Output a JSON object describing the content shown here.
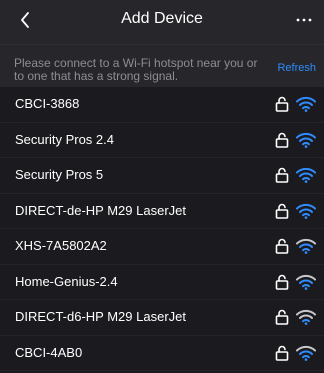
{
  "header": {
    "title": "Add Device",
    "back_icon": "chevron-left-icon",
    "more_icon": "ellipsis-icon"
  },
  "banner": {
    "message": "Please connect to a Wi-Fi hotspot near you or to one that has a strong signal.",
    "refresh_label": "Refresh"
  },
  "colors": {
    "accent": "#2f8cff",
    "background": "#1b1b1f",
    "header_background": "#26262b",
    "muted_text": "#8d8d94",
    "icon_dim": "#c8c8cc"
  },
  "networks": [
    {
      "name": "CBCI-3868",
      "secured": true,
      "signal_bars": 3,
      "lock_icon": "lock-icon",
      "signal_icon": "wifi-signal-icon"
    },
    {
      "name": "Security Pros 2.4",
      "secured": true,
      "signal_bars": 3,
      "lock_icon": "lock-icon",
      "signal_icon": "wifi-signal-icon"
    },
    {
      "name": "Security Pros 5",
      "secured": true,
      "signal_bars": 3,
      "lock_icon": "lock-icon",
      "signal_icon": "wifi-signal-icon"
    },
    {
      "name": "DIRECT-de-HP M29 LaserJet",
      "secured": true,
      "signal_bars": 3,
      "lock_icon": "lock-icon",
      "signal_icon": "wifi-signal-icon"
    },
    {
      "name": "XHS-7A5802A2",
      "secured": true,
      "signal_bars": 2,
      "lock_icon": "lock-icon",
      "signal_icon": "wifi-signal-icon"
    },
    {
      "name": "Home-Genius-2.4",
      "secured": true,
      "signal_bars": 2,
      "lock_icon": "lock-icon",
      "signal_icon": "wifi-signal-icon"
    },
    {
      "name": "DIRECT-d6-HP M29 LaserJet",
      "secured": true,
      "signal_bars": 1,
      "lock_icon": "lock-icon",
      "signal_icon": "wifi-signal-icon"
    },
    {
      "name": "CBCI-4AB0",
      "secured": true,
      "signal_bars": 2,
      "lock_icon": "lock-icon",
      "signal_icon": "wifi-signal-icon"
    }
  ]
}
